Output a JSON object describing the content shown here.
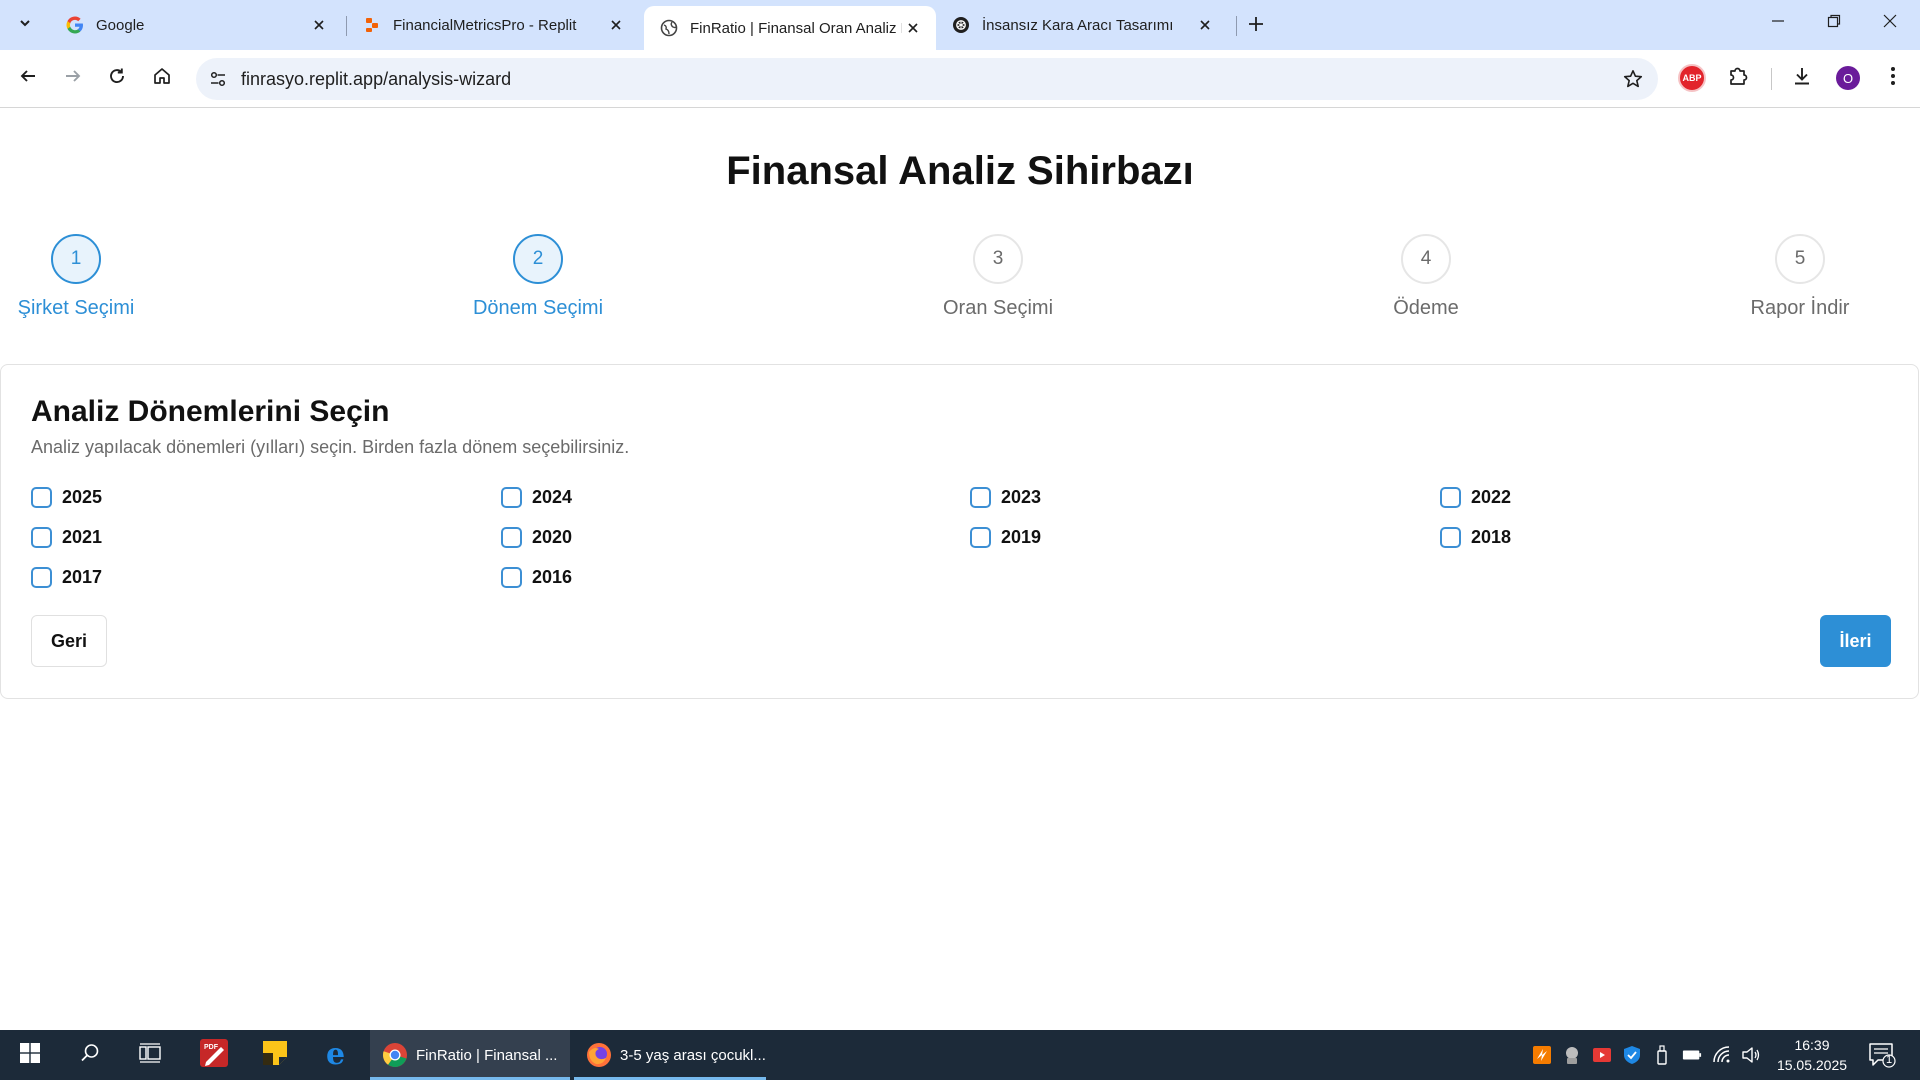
{
  "browser": {
    "tabs": [
      {
        "title": "Google",
        "favicon": "google-icon"
      },
      {
        "title": "FinancialMetricsPro - Replit",
        "favicon": "replit-icon"
      },
      {
        "title": "FinRatio | Finansal Oran Analiz Platformu",
        "favicon": "globe-icon",
        "active": true
      },
      {
        "title": "İnsansız Kara Aracı Tasarımı",
        "favicon": "openai-icon"
      }
    ],
    "url": "finrasyo.replit.app/analysis-wizard",
    "profile_initial": "O",
    "extension_badge": "ABP"
  },
  "page": {
    "title": "Finansal Analiz Sihirbazı",
    "steps": [
      {
        "number": "1",
        "label": "Şirket Seçimi",
        "state": "active"
      },
      {
        "number": "2",
        "label": "Dönem Seçimi",
        "state": "active"
      },
      {
        "number": "3",
        "label": "Oran Seçimi",
        "state": "inactive"
      },
      {
        "number": "4",
        "label": "Ödeme",
        "state": "inactive"
      },
      {
        "number": "5",
        "label": "Rapor İndir",
        "state": "inactive"
      }
    ],
    "card": {
      "title": "Analiz Dönemlerini Seçin",
      "description": "Analiz yapılacak dönemleri (yılları) seçin. Birden fazla dönem seçebilirsiniz.",
      "years": [
        "2025",
        "2024",
        "2023",
        "2022",
        "2021",
        "2020",
        "2019",
        "2018",
        "2017",
        "2016"
      ],
      "back_label": "Geri",
      "next_label": "İleri"
    },
    "accent_color": "#2d8fd6"
  },
  "taskbar": {
    "apps": [
      {
        "title": "FinRatio | Finansal ...",
        "icon": "chrome-icon",
        "active": true
      },
      {
        "title": "3-5 yaş arası çocukl...",
        "icon": "firefox-icon",
        "active": false
      }
    ],
    "time": "16:39",
    "date": "15.05.2025",
    "notification_count": "1"
  }
}
